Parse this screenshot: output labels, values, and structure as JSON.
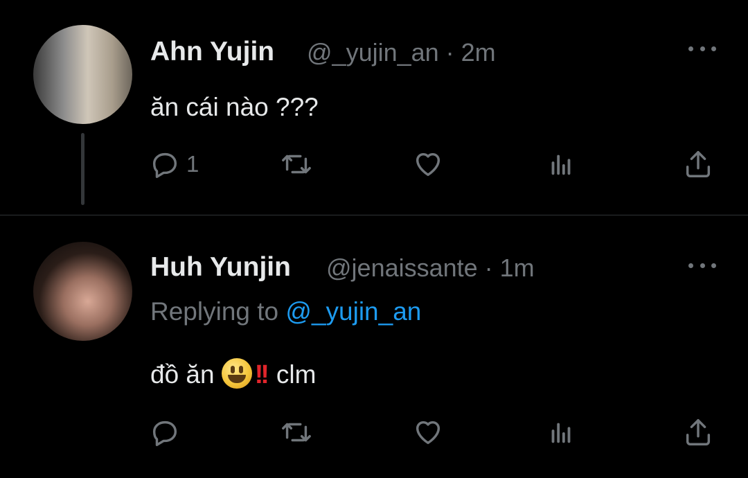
{
  "tweets": [
    {
      "name": "Ahn Yujin",
      "meta": "@_yujin_an · 2m",
      "text": "ăn cái nào ???",
      "reply_count": "1"
    },
    {
      "name": "Huh Yunjin",
      "meta": "@jenaissante · 1m",
      "reply_prefix": "Replying to",
      "reply_handle": "@_yujin_an",
      "text_before": "đồ ăn",
      "text_after": "clm",
      "reply_count": ""
    }
  ],
  "colors": {
    "background": "#000000",
    "text": "#e7e9ea",
    "muted": "#71767b",
    "link": "#1d9bf0",
    "divider": "#2f3336"
  },
  "icons": [
    "reply-icon",
    "retweet-icon",
    "like-icon",
    "views-icon",
    "share-icon",
    "more-icon"
  ]
}
